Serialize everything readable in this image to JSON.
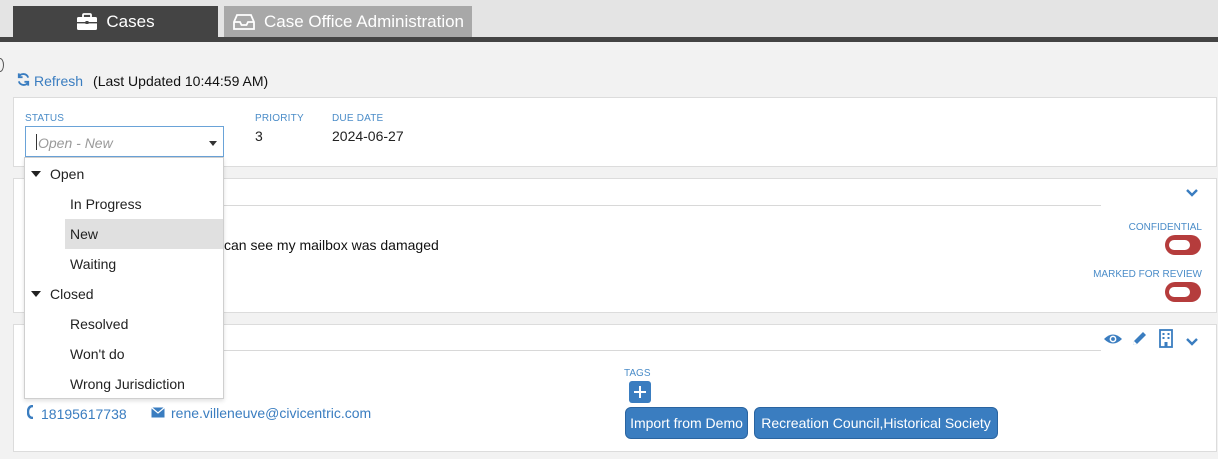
{
  "tabs": [
    {
      "label": "Cases",
      "icon": "briefcase-icon",
      "active": true
    },
    {
      "label": "Case Office Administration",
      "icon": "inbox-tray-icon",
      "active": false
    }
  ],
  "toolbar": {
    "refresh_label": "Refresh",
    "last_updated": "(Last Updated 10:44:59 AM)"
  },
  "status_panel": {
    "status_label": "STATUS",
    "status_placeholder": "Open - New",
    "priority_label": "PRIORITY",
    "priority_value": "3",
    "due_date_label": "DUE DATE",
    "due_date_value": "2024-06-27"
  },
  "status_dropdown": {
    "groups": [
      {
        "label": "Open",
        "items": [
          "In Progress",
          "New",
          "Waiting"
        ]
      },
      {
        "label": "Closed",
        "items": [
          "Resolved",
          "Won't do",
          "Wrong Jurisdiction"
        ]
      }
    ],
    "selected": "New"
  },
  "description_panel": {
    "text": "can see my mailbox was damaged",
    "confidential_label": "CONFIDENTIAL",
    "confidential_on": false,
    "review_label": "MARKED FOR REVIEW",
    "review_on": false
  },
  "contact_panel": {
    "phone": "18195617738",
    "email": "rene.villeneuve@civicentric.com",
    "tags_label": "TAGS",
    "tags": [
      "Import from Demo",
      "Recreation Council,Historical Society"
    ],
    "actions": [
      "eye-icon",
      "pencil-icon",
      "building-icon",
      "chevron-down-icon"
    ]
  },
  "colors": {
    "accent": "#3a7dc0",
    "toggle_off": "#b53c3c",
    "tab_active": "#444444",
    "tab_inactive": "#a8a8a8"
  }
}
